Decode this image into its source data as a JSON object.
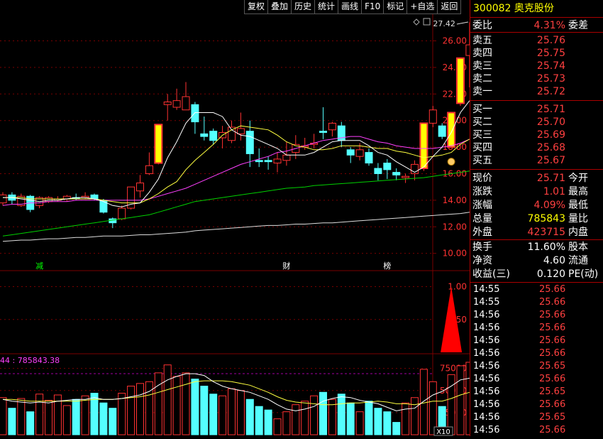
{
  "toolbar": {
    "items": [
      "复权",
      "叠加",
      "历史",
      "统计",
      "画线",
      "F10",
      "标记",
      "+自选",
      "返回"
    ]
  },
  "stock": {
    "code": "300082",
    "name": "奥克股份"
  },
  "colors": {
    "up": "#ff3232",
    "down": "#54ffff",
    "bg": "#000000",
    "grid": "#7a0000",
    "accent": "#ffff00"
  },
  "quote": {
    "weibi": {
      "label": "委比",
      "value": "4.31%",
      "label2": "委差"
    },
    "sell": [
      {
        "label": "卖五",
        "price": "25.76"
      },
      {
        "label": "卖四",
        "price": "25.75"
      },
      {
        "label": "卖三",
        "price": "25.74"
      },
      {
        "label": "卖二",
        "price": "25.73"
      },
      {
        "label": "卖一",
        "price": "25.72"
      }
    ],
    "buy": [
      {
        "label": "买一",
        "price": "25.71"
      },
      {
        "label": "买二",
        "price": "25.70"
      },
      {
        "label": "买三",
        "price": "25.69"
      },
      {
        "label": "买四",
        "price": "25.68"
      },
      {
        "label": "买五",
        "price": "25.67"
      }
    ],
    "stats": [
      {
        "label": "现价",
        "value": "25.71",
        "label2": "今开",
        "color": "red"
      },
      {
        "label": "涨跌",
        "value": "1.01",
        "label2": "最高",
        "color": "red"
      },
      {
        "label": "涨幅",
        "value": "4.09%",
        "label2": "最低",
        "color": "red"
      },
      {
        "label": "总量",
        "value": "785843",
        "label2": "量比",
        "color": "yellow"
      },
      {
        "label": "外盘",
        "value": "423715",
        "label2": "内盘",
        "color": "red"
      }
    ],
    "stats2": [
      {
        "label": "换手",
        "value": "11.60%",
        "label2": "股本",
        "color": "white"
      },
      {
        "label": "净资",
        "value": "4.60",
        "label2": "流通",
        "color": "white"
      },
      {
        "label": "收益(三)",
        "value": "0.120",
        "label2": "PE(动)",
        "color": "white"
      }
    ]
  },
  "ticks": [
    {
      "time": "14:55",
      "price": "25.66"
    },
    {
      "time": "14:55",
      "price": "25.66"
    },
    {
      "time": "14:56",
      "price": "25.66"
    },
    {
      "time": "14:56",
      "price": "25.66"
    },
    {
      "time": "14:56",
      "price": "25.66"
    },
    {
      "time": "14:56",
      "price": "25.66"
    },
    {
      "time": "14:56",
      "price": "25.65"
    },
    {
      "time": "14:56",
      "price": "25.66"
    },
    {
      "time": "14:56",
      "price": "25.65"
    },
    {
      "time": "14:56",
      "price": "25.66"
    },
    {
      "time": "14:56",
      "price": "25.65"
    },
    {
      "time": "14:56",
      "price": "25.66"
    }
  ],
  "chart": {
    "price_axis": [
      "26.00",
      "24.00",
      "22.00",
      "20.00",
      "18.00",
      "16.00",
      "14.00",
      "12.00",
      "10.00"
    ],
    "max_label": "27.42",
    "markers": [
      "减",
      "财",
      "榜"
    ],
    "indicator_axis": [
      "1.00",
      "0.50"
    ],
    "volume_header": "44 : 785843.38",
    "volume_axis": [
      "75000",
      "50000",
      "25000"
    ],
    "volume_unit": "X10"
  },
  "chart_data": {
    "type": "candlestick",
    "y_range": [
      9.5,
      27.9
    ],
    "candles": [
      [
        13.8,
        14.4,
        14.6,
        13.6
      ],
      [
        14.4,
        14.0,
        14.6,
        13.7
      ],
      [
        13.6,
        14.3,
        14.5,
        13.5
      ],
      [
        14.3,
        13.3,
        14.4,
        13.1
      ],
      [
        13.6,
        14.2,
        14.3,
        13.4
      ],
      [
        13.9,
        14.2,
        14.3,
        13.8
      ],
      [
        14.0,
        14.1,
        14.3,
        13.9
      ],
      [
        14.1,
        14.3,
        14.4,
        13.9
      ],
      [
        14.2,
        14.1,
        14.5,
        14.0
      ],
      [
        14.2,
        14.3,
        14.6,
        14.1
      ],
      [
        14.4,
        14.1,
        14.5,
        14.0
      ],
      [
        14.0,
        13.1,
        14.1,
        13.0
      ],
      [
        12.6,
        12.3,
        12.7,
        11.9
      ],
      [
        12.6,
        13.4,
        13.6,
        12.5
      ],
      [
        13.4,
        15.0,
        15.0,
        13.3
      ],
      [
        14.7,
        15.3,
        15.9,
        14.2
      ],
      [
        16.0,
        16.6,
        17.6,
        15.9
      ],
      [
        16.8,
        19.7,
        19.7,
        16.7
      ],
      [
        21.2,
        21.4,
        22.0,
        20.0
      ],
      [
        21.0,
        21.5,
        22.4,
        20.8
      ],
      [
        20.8,
        21.8,
        22.9,
        20.8
      ],
      [
        21.2,
        19.9,
        21.4,
        19.0
      ],
      [
        19.0,
        18.8,
        20.3,
        18.5
      ],
      [
        19.2,
        18.5,
        19.4,
        18.2
      ],
      [
        18.7,
        19.1,
        19.6,
        17.9
      ],
      [
        18.5,
        19.5,
        20.0,
        18.3
      ],
      [
        19.0,
        19.4,
        20.6,
        18.5
      ],
      [
        19.2,
        17.5,
        20.0,
        16.5
      ],
      [
        17.0,
        16.9,
        17.9,
        16.5
      ],
      [
        17.0,
        16.9,
        17.3,
        16.3
      ],
      [
        16.8,
        17.1,
        17.6,
        16.1
      ],
      [
        17.0,
        17.4,
        18.4,
        16.6
      ],
      [
        17.6,
        18.2,
        18.9,
        17.1
      ],
      [
        18.0,
        18.1,
        18.7,
        17.8
      ],
      [
        18.2,
        18.3,
        19.0,
        17.9
      ],
      [
        19.2,
        19.1,
        21.0,
        18.6
      ],
      [
        19.3,
        19.8,
        19.9,
        18.8
      ],
      [
        19.6,
        18.5,
        19.9,
        18.0
      ],
      [
        17.8,
        17.4,
        18.0,
        16.8
      ],
      [
        17.3,
        17.8,
        18.3,
        17.0
      ],
      [
        17.6,
        16.8,
        17.9,
        16.6
      ],
      [
        16.4,
        16.0,
        16.8,
        15.5
      ],
      [
        16.8,
        16.3,
        17.1,
        15.6
      ],
      [
        16.1,
        15.9,
        16.4,
        15.5
      ],
      [
        15.7,
        15.8,
        16.0,
        15.3
      ],
      [
        16.0,
        16.7,
        17.0,
        15.5
      ],
      [
        16.4,
        19.8,
        19.8,
        16.2
      ],
      [
        19.8,
        20.8,
        21.1,
        19.5
      ],
      [
        19.6,
        18.8,
        19.8,
        18.6
      ],
      [
        18.0,
        20.6,
        20.6,
        18.0
      ],
      [
        21.3,
        24.7,
        24.7,
        21.1
      ],
      [
        24.9,
        25.7,
        27.4,
        22.5
      ]
    ],
    "ma5": [
      14.2,
      14.2,
      14.1,
      14.0,
      13.9,
      14.0,
      14.0,
      14.1,
      14.2,
      14.2,
      14.1,
      13.9,
      13.6,
      13.5,
      13.7,
      13.8,
      14.6,
      15.6,
      17.2,
      18.4,
      19.8,
      20.6,
      20.6,
      20.6,
      20.3,
      19.3,
      18.9,
      18.8,
      18.5,
      18.2,
      17.9,
      17.4,
      17.4,
      17.4,
      17.6,
      18.0,
      18.4,
      18.5,
      18.5,
      18.5,
      18.1,
      17.6,
      17.4,
      16.9,
      16.5,
      16.1,
      16.5,
      17.3,
      18.0,
      19.1,
      20.6,
      21.5
    ],
    "ma10": [
      14.2,
      14.2,
      14.2,
      14.1,
      14.1,
      14.1,
      14.1,
      14.1,
      14.1,
      14.1,
      14.1,
      14.0,
      13.9,
      13.8,
      13.8,
      13.8,
      14.1,
      14.5,
      15.0,
      15.4,
      16.3,
      17.0,
      17.6,
      18.2,
      18.9,
      19.3,
      19.6,
      19.5,
      19.4,
      19.3,
      18.9,
      18.4,
      18.1,
      18.0,
      17.8,
      17.8,
      17.9,
      18.1,
      18.1,
      18.1,
      18.0,
      17.9,
      17.9,
      17.7,
      17.6,
      17.4,
      17.2,
      17.3,
      17.4,
      17.6,
      18.2,
      18.6
    ],
    "ma20": [
      13.6,
      13.7,
      13.7,
      13.8,
      13.8,
      13.9,
      13.9,
      13.9,
      14.0,
      14.0,
      14.0,
      14.0,
      14.0,
      14.0,
      14.0,
      14.0,
      14.1,
      14.3,
      14.5,
      14.7,
      14.9,
      15.2,
      15.5,
      15.8,
      16.1,
      16.4,
      16.7,
      16.9,
      17.1,
      17.3,
      17.6,
      17.7,
      17.9,
      18.1,
      18.3,
      18.5,
      18.6,
      18.7,
      18.8,
      18.8,
      18.6,
      18.4,
      18.3,
      18.1,
      18.0,
      17.9,
      17.9,
      17.9,
      18.0,
      18.1,
      18.3,
      18.6
    ],
    "ma60": [
      11.3,
      11.4,
      11.5,
      11.6,
      11.7,
      11.8,
      11.9,
      12.0,
      12.1,
      12.2,
      12.3,
      12.4,
      12.5,
      12.6,
      12.7,
      12.8,
      12.9,
      13.1,
      13.3,
      13.5,
      13.7,
      13.9,
      14.0,
      14.1,
      14.2,
      14.3,
      14.4,
      14.5,
      14.6,
      14.7,
      14.8,
      14.9,
      14.95,
      15.0,
      15.1,
      15.15,
      15.2,
      15.25,
      15.3,
      15.35,
      15.4,
      15.45,
      15.5,
      15.55,
      15.6,
      15.65,
      15.7,
      15.8,
      15.9,
      16.0,
      16.1,
      16.2
    ],
    "ma120": [
      10.9,
      10.95,
      11.0,
      11.0,
      11.05,
      11.1,
      11.1,
      11.15,
      11.2,
      11.2,
      11.25,
      11.3,
      11.3,
      11.3,
      11.35,
      11.4,
      11.4,
      11.45,
      11.5,
      11.55,
      11.6,
      11.7,
      11.75,
      11.8,
      11.85,
      11.9,
      11.95,
      12.0,
      12.05,
      12.1,
      12.1,
      12.15,
      12.2,
      12.2,
      12.25,
      12.3,
      12.3,
      12.35,
      12.4,
      12.45,
      12.5,
      12.55,
      12.6,
      12.65,
      12.7,
      12.75,
      12.8,
      12.85,
      12.9,
      12.95,
      13.0,
      13.1
    ],
    "indicator": {
      "range": [
        0,
        1.2
      ],
      "spike_index": 49,
      "spike_value": 1.0
    },
    "volume": {
      "range": [
        0,
        90000
      ],
      "values": [
        42000,
        30000,
        41000,
        26000,
        46000,
        39000,
        45000,
        33000,
        40000,
        44000,
        47000,
        36000,
        30000,
        47000,
        55000,
        58000,
        60000,
        70000,
        79000,
        66000,
        70000,
        63000,
        55000,
        46000,
        44000,
        52000,
        50000,
        40000,
        32000,
        28000,
        18000,
        26000,
        34000,
        38000,
        44000,
        48000,
        40000,
        46000,
        36000,
        26000,
        38000,
        30000,
        26000,
        14000,
        36000,
        42000,
        74000,
        60000,
        32000,
        68000,
        78000,
        82000
      ],
      "ma5": [
        40000,
        38000,
        37000,
        36000,
        37000,
        36000,
        38000,
        39000,
        40000,
        40000,
        42000,
        40000,
        40000,
        41000,
        43000,
        45000,
        49000,
        56000,
        62000,
        66000,
        69000,
        69000,
        67000,
        60000,
        55000,
        52000,
        50000,
        48000,
        44000,
        40000,
        34000,
        29000,
        27000,
        29000,
        32000,
        38000,
        41000,
        43000,
        42000,
        39000,
        37000,
        35000,
        31000,
        27000,
        29000,
        30000,
        38000,
        45000,
        49000,
        55000,
        62000,
        64000
      ],
      "ma10": [
        40000,
        40000,
        39000,
        38000,
        38000,
        38000,
        38000,
        38000,
        38000,
        39000,
        40000,
        40000,
        40000,
        41000,
        42000,
        43000,
        45000,
        48000,
        51000,
        54000,
        57000,
        60000,
        61000,
        61000,
        61000,
        60000,
        58000,
        56000,
        52000,
        48000,
        43000,
        39000,
        37000,
        36000,
        35000,
        34000,
        34000,
        35000,
        36000,
        36000,
        37000,
        38000,
        37000,
        35000,
        35000,
        34000,
        36000,
        38000,
        38000,
        41000,
        45000,
        48000
      ]
    }
  }
}
